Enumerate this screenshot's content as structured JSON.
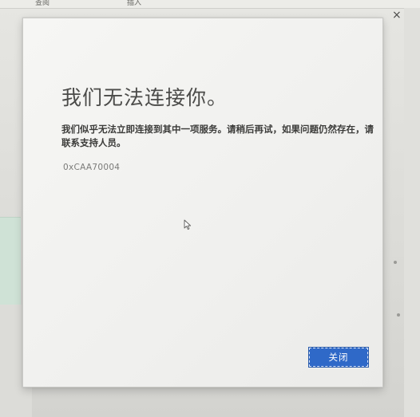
{
  "background": {
    "tabs": [
      "查阅",
      "插入"
    ],
    "close_glyph": "×"
  },
  "dialog": {
    "title": "我们无法连接你。",
    "message": "我们似乎无法立即连接到其中一项服务。请稍后再试，如果问题仍然存在，请联系支持人员。",
    "error_code": "0xCAA70004",
    "close_button_label": "关闭"
  },
  "colors": {
    "accent": "#2f69c8",
    "dialog_bg": "#f2f2f0",
    "title_text": "#4b4b49"
  },
  "icons": {
    "cursor": "arrow-cursor-icon",
    "background_close": "close-icon"
  }
}
